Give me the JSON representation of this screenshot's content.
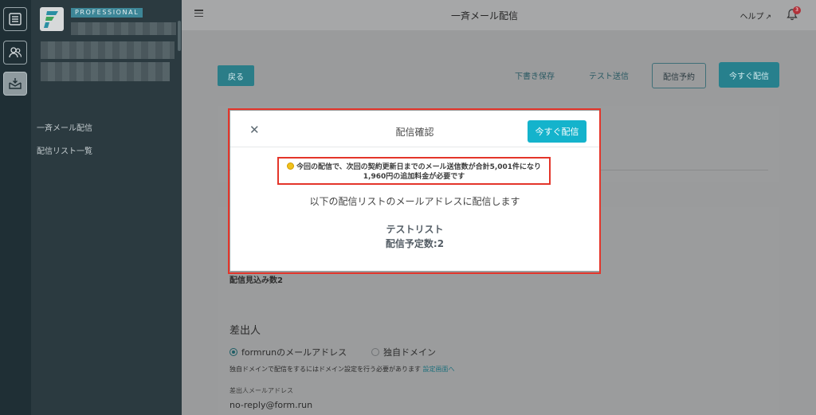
{
  "sidebar": {
    "plan": "PROFESSIONAL",
    "links": [
      "一斉メール配信",
      "配信リスト一覧"
    ]
  },
  "topbar": {
    "title": "一斉メール配信",
    "help": "ヘルプ",
    "notification_count": "3"
  },
  "actions": {
    "back": "戻る",
    "draft": "下書き保存",
    "test": "テスト送信",
    "reserve": "配信予約",
    "send_now": "今すぐ配信"
  },
  "form": {
    "estimate": "配信見込み数2",
    "sender_heading": "差出人",
    "option_formrun": "formrunのメールアドレス",
    "option_domain": "独自ドメイン",
    "domain_note": "独自ドメインで配信をするにはドメイン設定を行う必要があります",
    "domain_link": "設定画面へ",
    "address_label": "差出人メールアドレス",
    "address_value": "no-reply@form.run"
  },
  "modal": {
    "title": "配信確認",
    "send_now": "今すぐ配信",
    "notice_line1": "今回の配信で、次回の契約更新日までのメール送信数が合計5,001件になり",
    "notice_line2": "1,960円の追加料金が必要です",
    "lead": "以下の配信リストのメールアドレスに配信します",
    "list_name": "テストリスト",
    "planned_count": "配信予定数:2"
  },
  "colors": {
    "accent": "#14b3cc",
    "highlight": "#e4352a",
    "warning": "#f1c21b"
  }
}
